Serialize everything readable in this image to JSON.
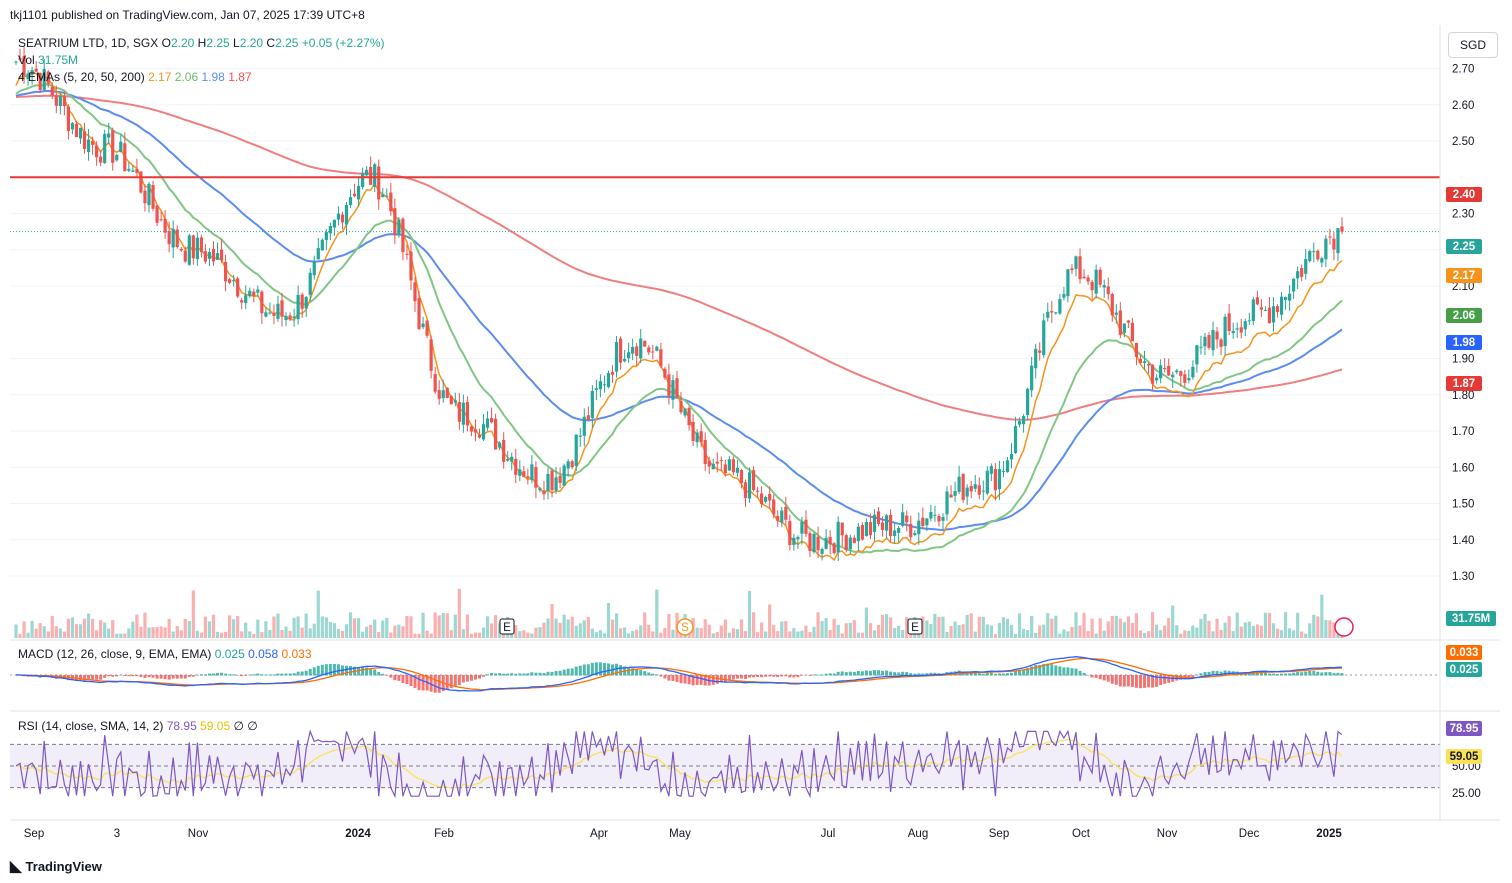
{
  "header": {
    "text": "tkj1101 published on TradingView.com, Jan 07, 2025 17:39 UTC+8"
  },
  "currency_button": "SGD",
  "legend": {
    "symbol": "SEATRIUM LTD, 1D, SGX",
    "o_label": "O",
    "o": "2.20",
    "h_label": "H",
    "h": "2.25",
    "l_label": "L",
    "l": "2.20",
    "c_label": "C",
    "c": "2.25",
    "change": "+0.05 (+2.27%)",
    "vol_label": "Vol",
    "vol_value": "31.75M",
    "ema_label": "4 EMAs (5, 20, 50, 200)",
    "ema_values": [
      "2.17",
      "2.06",
      "1.98",
      "1.87"
    ]
  },
  "macd_legend": {
    "label": "MACD (12, 26, close, 9, EMA, EMA)",
    "values": [
      "0.025",
      "0.058",
      "0.033"
    ]
  },
  "rsi_legend": {
    "label": "RSI (14, close, SMA, 14, 2)",
    "values": [
      "78.95",
      "59.05"
    ],
    "extra": "∅ ∅"
  },
  "price_axis": {
    "ticks": [
      "2.70",
      "2.60",
      "2.50",
      "2.30",
      "2.20",
      "2.10",
      "1.90",
      "1.80",
      "1.70",
      "1.60",
      "1.50",
      "1.40",
      "1.30"
    ]
  },
  "price_tags": {
    "resistance": "2.40",
    "last": "2.25",
    "ema5": "2.17",
    "ema20": "2.06",
    "ema50": "1.98",
    "ema200": "1.87",
    "volume": "31.75M"
  },
  "macd_tags": {
    "a": "0.033",
    "b": "0.025"
  },
  "rsi_axis": {
    "ticks": [
      "50.00",
      "25.00"
    ],
    "tag_rsi": "78.95",
    "tag_ma": "59.05"
  },
  "time_axis": {
    "labels": [
      "Sep",
      "3",
      "Nov",
      "2024",
      "Feb",
      "Apr",
      "May",
      "Jul",
      "Aug",
      "Sep",
      "Oct",
      "Nov",
      "Dec",
      "2025"
    ]
  },
  "markers": {
    "earnings": "E",
    "split": "S"
  },
  "footer": {
    "brand": "TradingView"
  },
  "colors": {
    "up": "#26a69a",
    "down": "#ef5350",
    "ema5": "#f7931a",
    "ema20": "#81c784",
    "ema50": "#5b8def",
    "ema200": "#ef7e7e",
    "resistance": "#e53935",
    "rsi": "#7e57c2",
    "rsi_ma": "#f9e25a"
  },
  "chart_data": {
    "type": "candlestick",
    "title": "SEATRIUM LTD, 1D, SGX",
    "resistance_level": 2.4,
    "ylim": [
      1.22,
      2.82
    ],
    "key_points": [
      {
        "x": "Sep 2023",
        "close": 2.72
      },
      {
        "x": "Oct 2023",
        "close": 2.48
      },
      {
        "x": "Nov 2023",
        "close": 2.2
      },
      {
        "x": "Dec 2023",
        "close": 2.02
      },
      {
        "x": "Jan 2024",
        "close": 2.4
      },
      {
        "x": "Feb 2024",
        "close": 1.75
      },
      {
        "x": "Mar 2024",
        "close": 1.57
      },
      {
        "x": "May 2024",
        "close": 1.95
      },
      {
        "x": "Jun 2024",
        "close": 1.58
      },
      {
        "x": "Jul 2024",
        "close": 1.4
      },
      {
        "x": "Aug 2024",
        "close": 1.44
      },
      {
        "x": "Sep 2024",
        "close": 1.57
      },
      {
        "x": "Oct 2024",
        "close": 2.14
      },
      {
        "x": "Nov 2024",
        "close": 1.85
      },
      {
        "x": "Dec 2024",
        "close": 2.02
      },
      {
        "x": "Jan 2025",
        "close": 2.25
      }
    ],
    "series": [
      {
        "name": "EMA 5",
        "last": 2.17
      },
      {
        "name": "EMA 20",
        "last": 2.06
      },
      {
        "name": "EMA 50",
        "last": 1.98
      },
      {
        "name": "EMA 200",
        "last": 1.87
      }
    ],
    "volume_last": "31.75M",
    "macd": {
      "macd": 0.025,
      "signal": 0.058,
      "histogram": 0.033
    },
    "rsi": {
      "rsi": 78.95,
      "rsi_ma": 59.05,
      "levels": [
        70,
        50,
        30
      ]
    }
  }
}
